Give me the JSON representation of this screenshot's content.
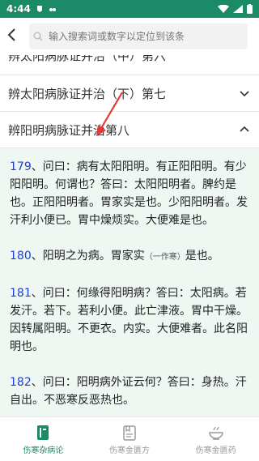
{
  "status": {
    "time": "4:44"
  },
  "search": {
    "placeholder": "输入搜索词或数字以定位到该条"
  },
  "chapters": {
    "partial": "辨太阳病脉证并治（中）第六",
    "seven": "辨太阳病脉证并治（下）第七",
    "eight": "辨阳明病脉证并治第八"
  },
  "paras": [
    {
      "num": "179",
      "text": "、问曰：病有太阳阳明。有正阳阳明。有少阳阳明。何谓也？答曰：太阳阳明者。脾约是也。正阳阳明者。胃家实是也。少阳阳明者。发汗利小便已。胃中燥烦实。大便难是也。"
    },
    {
      "num": "180",
      "text_a": "、阳明之为病。胃家实",
      "note": "（一作寒）",
      "text_b": "是也。"
    },
    {
      "num": "181",
      "text": "、问曰：何缘得阳明病？答曰：太阳病。若发汗。若下。若利小便。此亡津液。胃中干燥。因转属阳明。不更衣。内实。大便难者。此名阳明也。"
    },
    {
      "num": "182",
      "text": "、问曰：阳明病外证云何？答曰：身热。汗自出。不恶寒反恶热也。"
    }
  ],
  "tabs": [
    {
      "label": "伤寒杂病论"
    },
    {
      "label": "伤寒金匮方"
    },
    {
      "label": "伤寒金匮药"
    }
  ],
  "colors": {
    "accent": "#1a8a67",
    "number": "#1c3fd1",
    "content_bg": "#eef7f2",
    "arrow": "#e53935"
  }
}
